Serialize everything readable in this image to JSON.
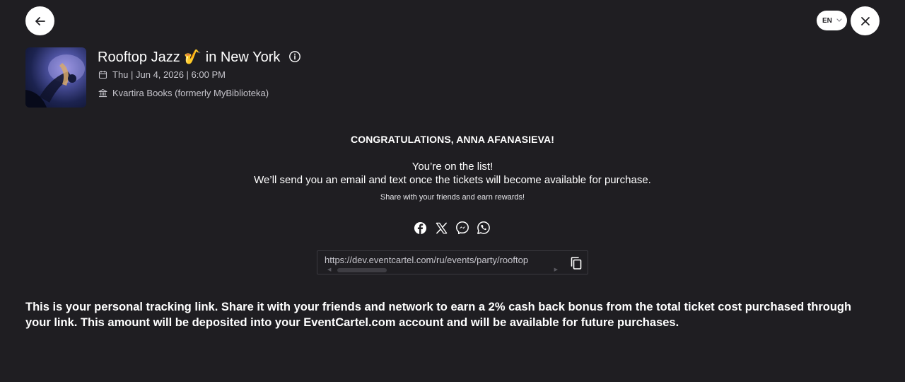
{
  "header": {
    "back_icon": "arrow-left-icon",
    "close_icon": "close-icon",
    "language": "EN",
    "language_icon": "chevron-down-icon"
  },
  "event": {
    "title": "Rooftop Jazz 🎷 in New York",
    "info_icon": "info-icon",
    "date_icon": "calendar-icon",
    "date": "Thu | Jun 4, 2026 | 6:00 PM",
    "venue_icon": "building-icon",
    "venue": "Kvartira Books (formerly MyBiblioteka)"
  },
  "confirmation": {
    "congrats": "CONGRATULATIONS, ANNA AFANASIEVA!",
    "on_list": "You’re on the list!",
    "send_note": "We’ll send you an email and text once the tickets will become available for purchase.",
    "share_note": "Share with your friends and earn rewards!"
  },
  "social": [
    {
      "name": "facebook-icon"
    },
    {
      "name": "x-icon"
    },
    {
      "name": "messenger-icon"
    },
    {
      "name": "whatsapp-icon"
    }
  ],
  "share_link": {
    "value": "https://dev.eventcartel.com/ru/events/party/rooftop",
    "copy_icon": "copy-icon"
  },
  "tracking_note": "This is your personal tracking link. Share it with your friends and network to earn a 2% cash back bonus from the total ticket cost purchased through your link. This amount will be deposited into your EventCartel.com account and will be available for future purchases.",
  "colors": {
    "background": "#1f1e22",
    "text": "#ffffff",
    "muted_text": "#c6c5cc"
  }
}
